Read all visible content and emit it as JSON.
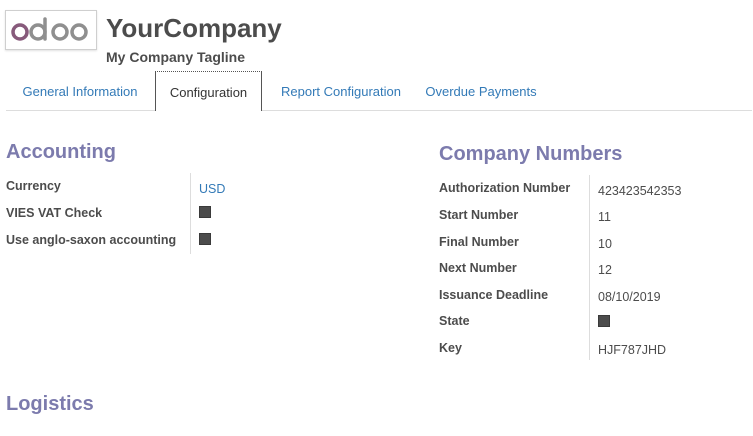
{
  "header": {
    "logo_text": "odoo",
    "company_name": "YourCompany",
    "tagline": "My Company Tagline"
  },
  "tabs": [
    {
      "label": "General Information",
      "active": false
    },
    {
      "label": "Configuration",
      "active": true
    },
    {
      "label": "Report Configuration",
      "active": false
    },
    {
      "label": "Overdue Payments",
      "active": false
    }
  ],
  "accounting": {
    "title": "Accounting",
    "fields": [
      {
        "label": "Currency",
        "value": "USD",
        "type": "link"
      },
      {
        "label": "VIES VAT Check",
        "value": "",
        "type": "checkbox"
      },
      {
        "label": "Use anglo-saxon accounting",
        "value": "",
        "type": "checkbox"
      }
    ]
  },
  "company_numbers": {
    "title": "Company Numbers",
    "fields": [
      {
        "label": "Authorization Number",
        "value": "423423542353",
        "type": "text"
      },
      {
        "label": "Start Number",
        "value": "11",
        "type": "text"
      },
      {
        "label": "Final Number",
        "value": "10",
        "type": "text"
      },
      {
        "label": "Next Number",
        "value": "12",
        "type": "text"
      },
      {
        "label": "Issuance Deadline",
        "value": "08/10/2019",
        "type": "text"
      },
      {
        "label": "State",
        "value": "",
        "type": "checkbox"
      },
      {
        "label": "Key",
        "value": "HJF787JHD",
        "type": "text"
      }
    ]
  },
  "logistics": {
    "title": "Logistics"
  },
  "colors": {
    "brand_purple": "#875a7b",
    "logo_gray": "#8f8f8f",
    "section_title": "#7c7bad",
    "link": "#337ab7",
    "text": "#4c4c4c"
  }
}
